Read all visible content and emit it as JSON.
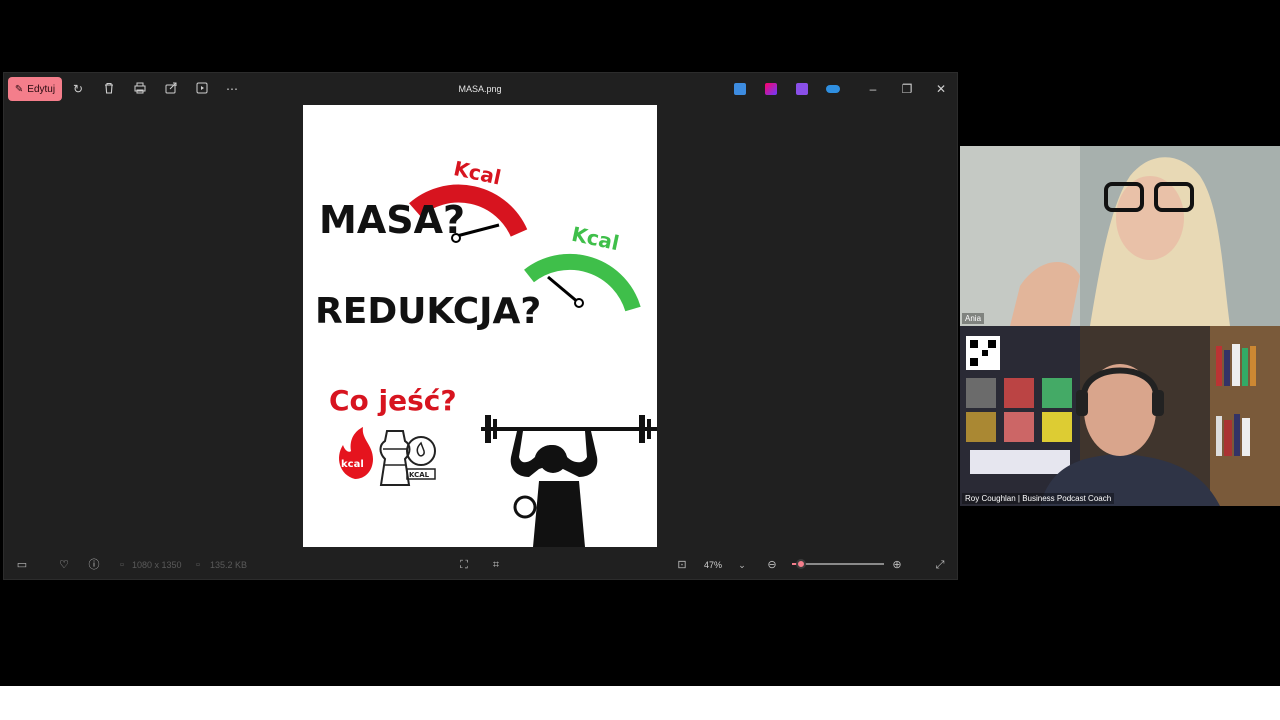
{
  "viewer": {
    "edit_label": "Edytuj",
    "file_name": "MASA.png",
    "dimensions": "1080 x 1350",
    "file_size": "135.2 KB",
    "zoom_level": "47%",
    "zoom_fraction": 0.1
  },
  "poster": {
    "masa": "MASA?",
    "reduk": "REDUKCJA?",
    "kcal_red": "Kcal",
    "kcal_green": "Kcal",
    "co_jesc": "Co jeść?",
    "flame_label": "kcal",
    "scale_label": "KCAL"
  },
  "participants": {
    "ania": "Ania",
    "roy": "Roy Coughlan | Business Podcast Coach"
  },
  "colors": {
    "accent": "#f47e8b",
    "poster_red": "#d7141f",
    "poster_green": "#3fbf4a"
  }
}
